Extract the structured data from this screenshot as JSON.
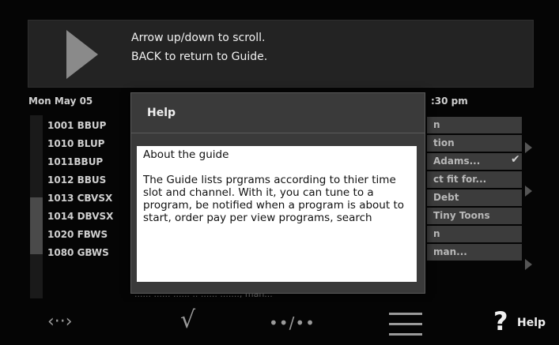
{
  "hint": {
    "line1": "Arrow up/down to scroll.",
    "line2": "BACK to return to Guide.",
    "icon": "play-icon"
  },
  "guide": {
    "date": "Mon May 05",
    "time": ":30 pm",
    "channels": [
      "1001 BBUP",
      "1010 BLUP",
      "1011BBUP",
      "1012 BBUS",
      "1013 CBVSX",
      "1014 DBVSX",
      "1020 FBWS",
      "1080 GBWS"
    ],
    "programs": [
      "n",
      "tion",
      "Adams...",
      "ct fit for...",
      "Debt",
      "Tiny Toons",
      "n",
      "man..."
    ],
    "bottom_row_text": "......   ...... ...... .. ...... ......., man..."
  },
  "dialog": {
    "title": "Help",
    "heading": "About the guide",
    "body": "The Guide lists prgrams according to thier time slot and channel. With it, you can tune to a program, be notified when a program is about to start, order pay per view programs, search"
  },
  "bottom_bar": {
    "nav_icon": "‹··›",
    "check_icon": "√",
    "page_icon": "••/••",
    "list_icon": "list-icon",
    "help_icon": "?",
    "help_label": "Help"
  }
}
